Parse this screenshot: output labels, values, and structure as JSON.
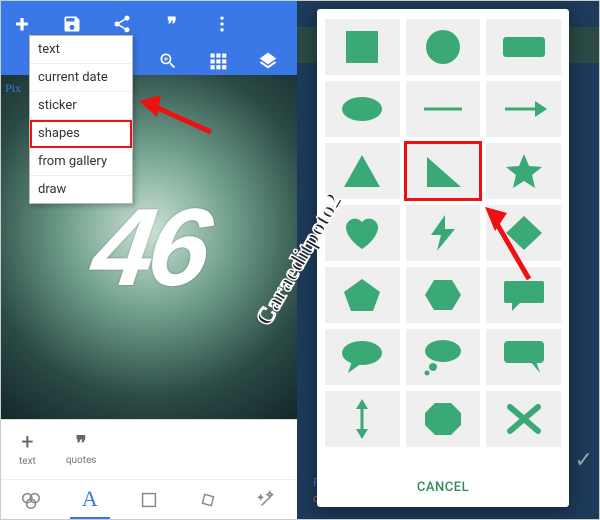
{
  "left": {
    "toolbar": {
      "plus": "+",
      "save": "save-icon",
      "share": "share-icon",
      "quote": "quote-icon",
      "more": "more-icon",
      "zoom": "zoom-icon",
      "grid": "grid-icon",
      "layers": "layers-icon"
    },
    "brand": "Pix",
    "canvas_text": "46",
    "dropdown": {
      "items": [
        "text",
        "current date",
        "sticker",
        "shapes",
        "from gallery",
        "draw"
      ],
      "highlighted_index": 3
    },
    "bottom": {
      "text_label": "text",
      "quotes_label": "quotes"
    },
    "tabs": [
      "filter",
      "letter",
      "crop",
      "rotate",
      "wand"
    ]
  },
  "right": {
    "dialog": {
      "shapes": [
        "square",
        "circle",
        "rect-rounded",
        "ellipse",
        "line",
        "arrow-right",
        "triangle",
        "right-triangle",
        "star",
        "heart",
        "bolt",
        "diamond",
        "pentagon",
        "hexagon",
        "speech-rect",
        "speech-oval",
        "thought-bubble",
        "callout",
        "double-arrow-v",
        "octagon",
        "x"
      ],
      "highlighted_index": 7,
      "cancel_label": "CANCEL"
    },
    "bg_hint1": "Fi",
    "bg_hint2": "opa"
  },
  "watermark": "Caraeditpoto2",
  "annotation": {
    "color": "#e11"
  }
}
